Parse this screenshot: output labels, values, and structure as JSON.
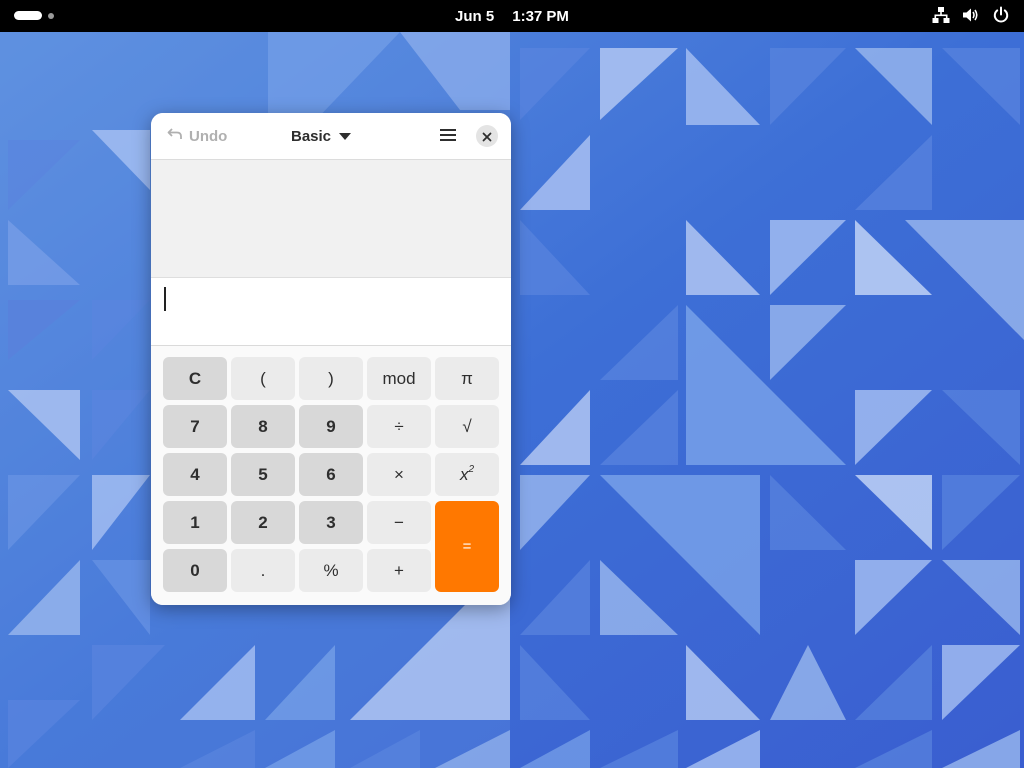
{
  "topbar": {
    "date": "Jun 5",
    "time": "1:37 PM",
    "icons": [
      "network-wired-icon",
      "volume-icon",
      "power-icon"
    ]
  },
  "calculator": {
    "undo_label": "Undo",
    "mode_label": "Basic",
    "entry_value": "",
    "keys": {
      "clear": "C",
      "open_paren": "(",
      "close_paren": ")",
      "mod": "mod",
      "pi": "π",
      "seven": "7",
      "eight": "8",
      "nine": "9",
      "divide": "÷",
      "sqrt": "√",
      "four": "4",
      "five": "5",
      "six": "6",
      "multiply": "×",
      "square_base": "x",
      "square_exp": "2",
      "one": "1",
      "two": "2",
      "three": "3",
      "minus": "−",
      "zero": "0",
      "point": ".",
      "percent": "%",
      "plus": "+",
      "equals": "="
    },
    "colors": {
      "equals": "#ff7800",
      "digit_key": "#d8d8d8",
      "operator_key": "#ebebeb"
    }
  }
}
